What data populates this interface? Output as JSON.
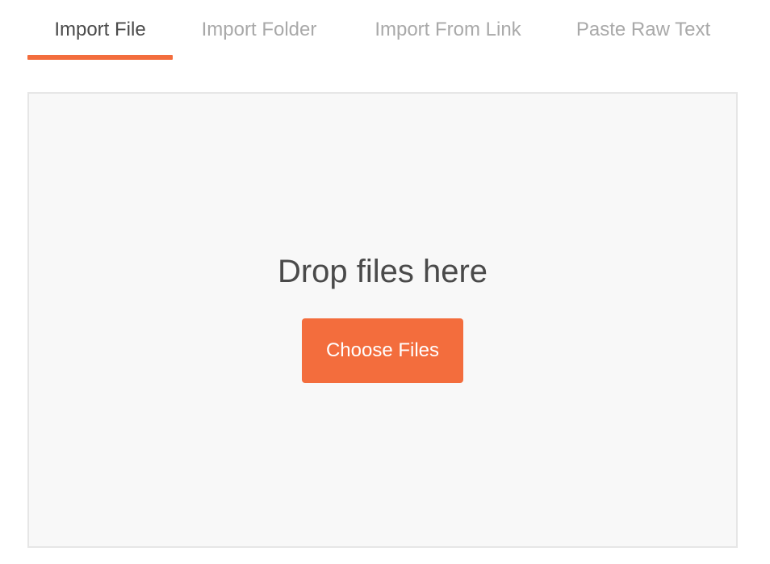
{
  "tabs": [
    {
      "label": "Import File",
      "active": true
    },
    {
      "label": "Import Folder",
      "active": false
    },
    {
      "label": "Import From Link",
      "active": false
    },
    {
      "label": "Paste Raw Text",
      "active": false
    }
  ],
  "dropzone": {
    "label": "Drop files here",
    "button_label": "Choose Files"
  },
  "colors": {
    "accent": "#f36d3d",
    "active_tab_text": "#4a4a4a",
    "inactive_tab_text": "#a9a9a9",
    "dropzone_background": "#f8f8f8",
    "dropzone_border": "#e6e6e6"
  }
}
